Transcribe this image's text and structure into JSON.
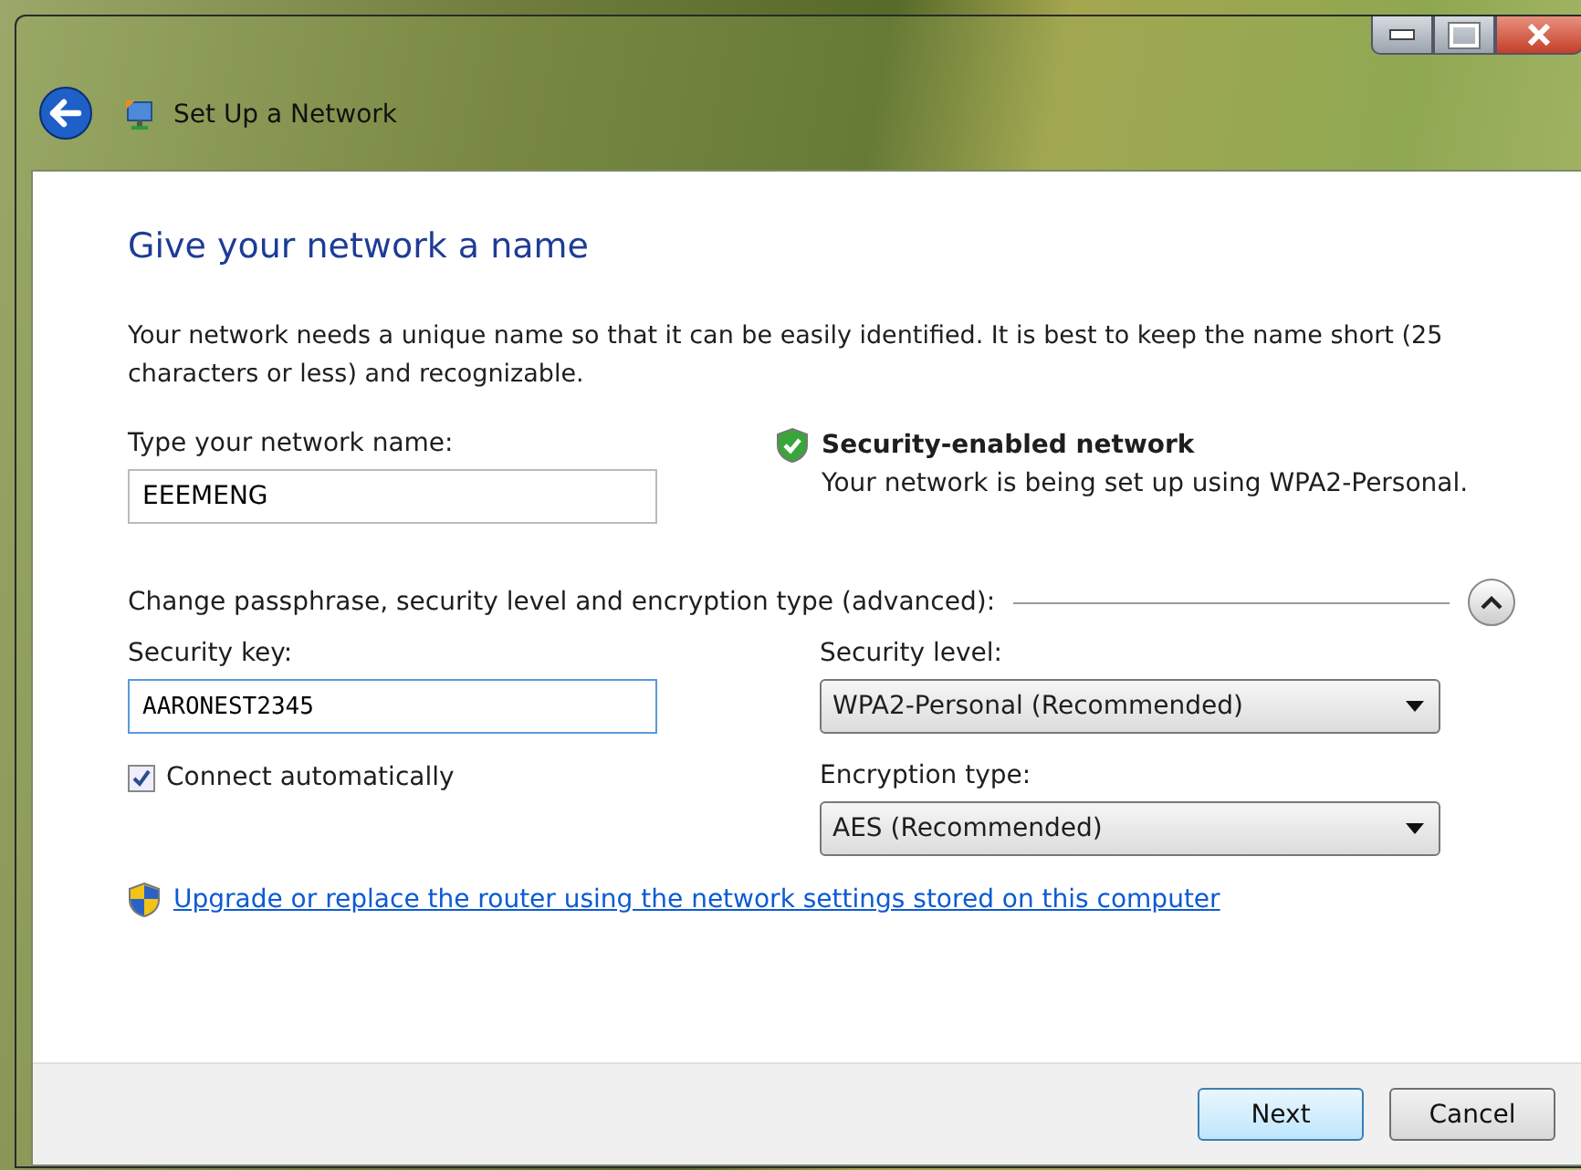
{
  "window": {
    "title": "Set Up a Network"
  },
  "heading": "Give your network a name",
  "intro": "Your network needs a unique name so that it can be easily identified. It is best to keep the name short (25 characters or less) and recognizable.",
  "network_name": {
    "label": "Type your network name:",
    "value": "EEEMENG"
  },
  "security_status": {
    "title": "Security-enabled network",
    "detail": "Your network is being set up using WPA2-Personal."
  },
  "advanced": {
    "label": "Change passphrase, security level and encryption type (advanced):",
    "expanded": true
  },
  "security_key": {
    "label": "Security key:",
    "value": "AARONEST2345"
  },
  "connect_automatically": {
    "label": "Connect automatically",
    "checked": true
  },
  "security_level": {
    "label": "Security level:",
    "value": "WPA2-Personal (Recommended)"
  },
  "encryption_type": {
    "label": "Encryption type:",
    "value": "AES (Recommended)"
  },
  "router_link": "Upgrade or replace the router using the network settings stored on this computer",
  "buttons": [
    {
      "label": "Next",
      "default": true
    },
    {
      "label": "Cancel",
      "default": false
    }
  ]
}
